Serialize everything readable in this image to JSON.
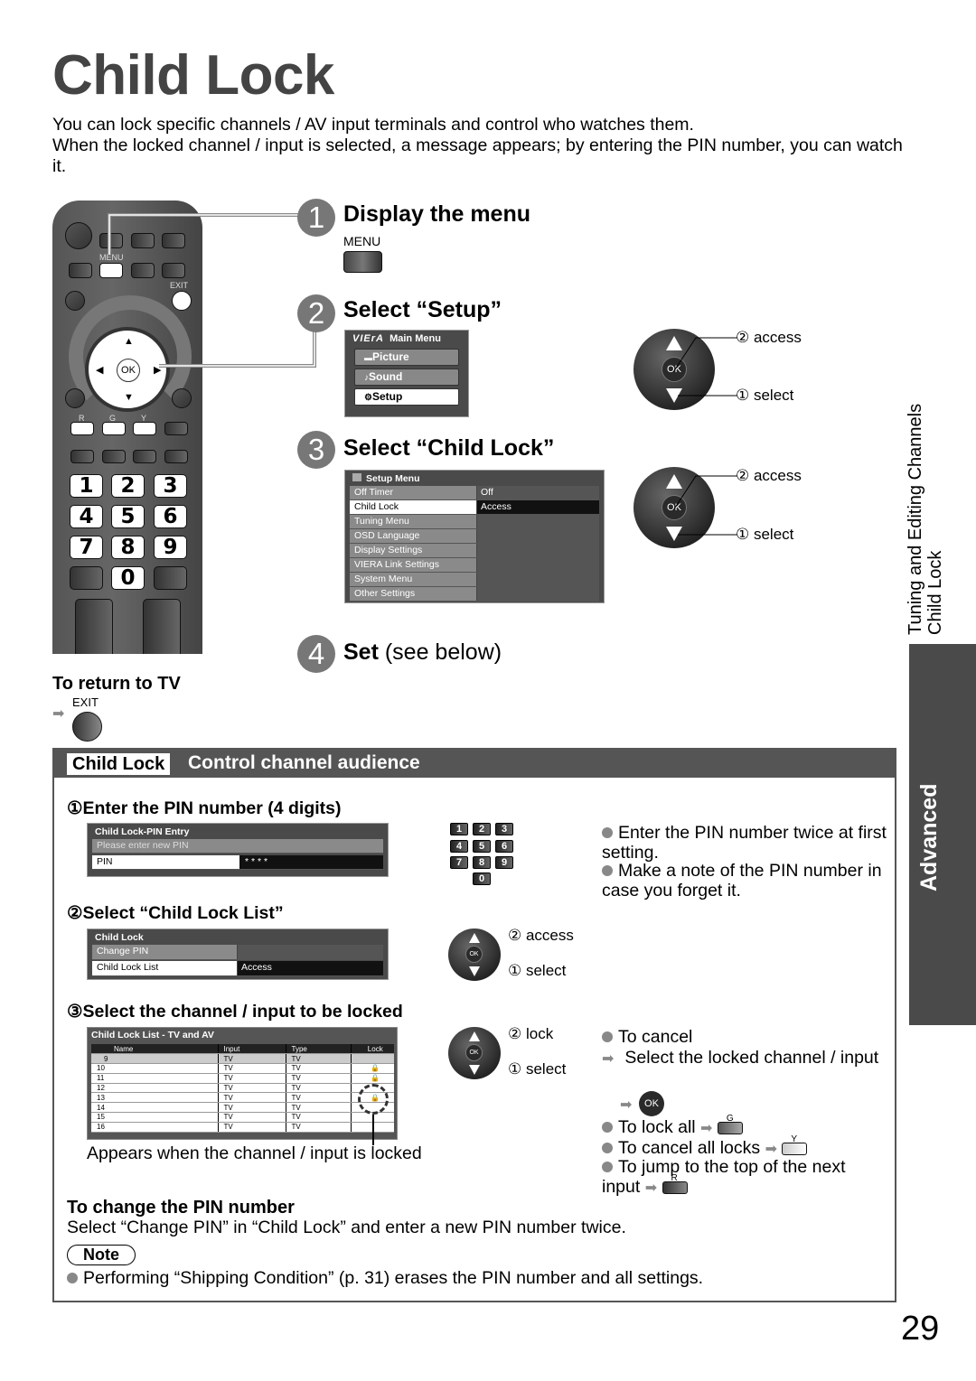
{
  "page": {
    "title": "Child Lock",
    "intro": [
      "You can lock specific channels / AV input terminals and control who watches them.",
      "When the locked channel / input is selected, a message appears; by entering the PIN number, you can watch it."
    ],
    "page_number": "29"
  },
  "side_tab": {
    "section_line1": "Tuning and Editing Channels",
    "section_line2": "Child Lock",
    "category": "Advanced"
  },
  "remote": {
    "labels": {
      "menu": "MENU",
      "exit": "EXIT",
      "ok": "OK",
      "r": "R",
      "g": "G",
      "y": "Y"
    },
    "number_keys": [
      "1",
      "2",
      "3",
      "4",
      "5",
      "6",
      "7",
      "8",
      "9",
      "0"
    ]
  },
  "steps": [
    {
      "num": "1",
      "title": "Display the menu",
      "button_label": "MENU"
    },
    {
      "num": "2",
      "title": "Select “Setup”"
    },
    {
      "num": "3",
      "title": "Select “Child Lock”"
    },
    {
      "num": "4",
      "title": "Set",
      "suffix": " (see below)"
    }
  ],
  "main_menu": {
    "logo": "VIErA",
    "title": "Main Menu",
    "items": [
      {
        "icon": "picture-icon",
        "glyph": "▬",
        "label": "Picture",
        "selected": false
      },
      {
        "icon": "sound-icon",
        "glyph": "♪",
        "label": "Sound",
        "selected": false
      },
      {
        "icon": "setup-icon",
        "glyph": "⚙",
        "label": "Setup",
        "selected": true
      }
    ]
  },
  "setup_menu": {
    "title": "Setup Menu",
    "rows": [
      {
        "label": "Off Timer",
        "value": "Off"
      },
      {
        "label": "Child Lock",
        "value": "Access",
        "selected": true
      },
      {
        "label": "Tuning Menu",
        "value": ""
      },
      {
        "label": "OSD Language",
        "value": ""
      },
      {
        "label": "Display Settings",
        "value": ""
      },
      {
        "label": "VIERA Link Settings",
        "value": ""
      },
      {
        "label": "System Menu",
        "value": ""
      },
      {
        "label": "Other Settings",
        "value": ""
      }
    ]
  },
  "nav_captions": {
    "access": "② access",
    "select": "① select",
    "lock": "② lock"
  },
  "return_tv": {
    "title": "To return to TV",
    "button_label": "EXIT"
  },
  "section": {
    "tag": "Child Lock",
    "heading": "Control channel audience",
    "step1": {
      "title": "①Enter the PIN number (4 digits)",
      "osd_title": "Child Lock-PIN Entry",
      "prompt": "Please enter new PIN",
      "field_label": "PIN",
      "field_value": "* * * *",
      "notes": [
        "Enter the PIN number twice at first setting.",
        "Make a note of the PIN number in case you forget it."
      ]
    },
    "step2": {
      "title": "②Select “Child Lock List”",
      "osd_title": "Child Lock",
      "rows": [
        {
          "label": "Change PIN",
          "value": ""
        },
        {
          "label": "Child Lock List",
          "value": "Access",
          "selected": true
        }
      ]
    },
    "step3": {
      "title": "③Select the channel / input to be locked",
      "table_title": "Child Lock List - TV and AV",
      "columns": [
        "Name",
        "Input",
        "Type",
        "Lock"
      ],
      "rows": [
        {
          "name": "9",
          "input": "TV",
          "type": "TV",
          "locked": false
        },
        {
          "name": "10",
          "input": "TV",
          "type": "TV",
          "locked": true
        },
        {
          "name": "11",
          "input": "TV",
          "type": "TV",
          "locked": true
        },
        {
          "name": "12",
          "input": "TV",
          "type": "TV",
          "locked": false
        },
        {
          "name": "13",
          "input": "TV",
          "type": "TV",
          "locked": true
        },
        {
          "name": "14",
          "input": "TV",
          "type": "TV",
          "locked": false
        },
        {
          "name": "15",
          "input": "TV",
          "type": "TV",
          "locked": false
        },
        {
          "name": "16",
          "input": "TV",
          "type": "TV",
          "locked": false
        }
      ],
      "caption": "Appears when the channel / input is locked",
      "tips": {
        "cancel": "To cancel",
        "cancel_detail": "Select the locked channel / input",
        "ok_label": "OK",
        "lock_all": "To lock all",
        "lock_all_key": "G",
        "cancel_all": "To cancel all locks",
        "cancel_all_key": "Y",
        "jump": "To jump to the top of the next input",
        "jump_key": "R"
      }
    },
    "change_pin": {
      "title": "To change the PIN number",
      "text": "Select “Change PIN” in “Child Lock” and enter a new PIN number twice."
    },
    "note": {
      "label": "Note",
      "text": "Performing “Shipping Condition” (p. 31) erases the PIN number and all settings."
    }
  }
}
